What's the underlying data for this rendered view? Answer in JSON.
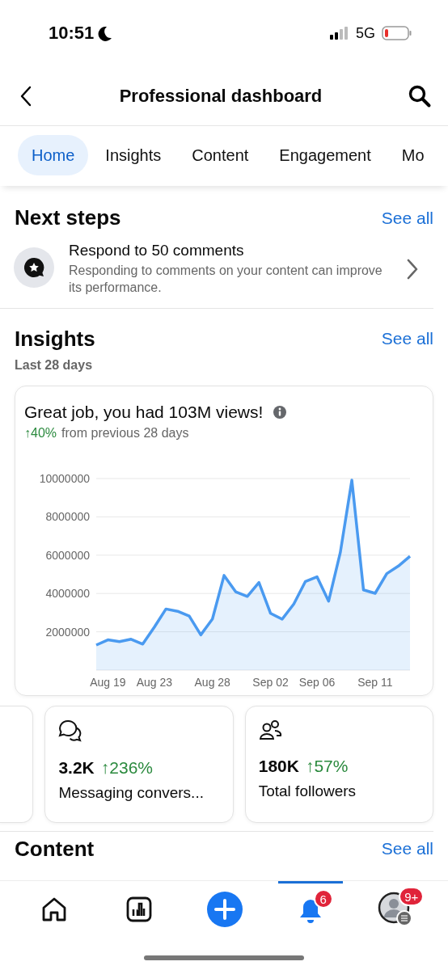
{
  "status_bar": {
    "time": "10:51",
    "network": "5G"
  },
  "header": {
    "title": "Professional dashboard"
  },
  "tabs": [
    {
      "label": "Home",
      "selected": true
    },
    {
      "label": "Insights",
      "selected": false
    },
    {
      "label": "Content",
      "selected": false
    },
    {
      "label": "Engagement",
      "selected": false
    },
    {
      "label": "Mo",
      "selected": false
    }
  ],
  "next_steps": {
    "title": "Next steps",
    "link": "See all",
    "items": [
      {
        "title": "Respond to 50 comments",
        "description": "Responding to comments on your content can improve its performance."
      }
    ]
  },
  "insights": {
    "title": "Insights",
    "link": "See all",
    "period": "Last 28 days",
    "card": {
      "headline": "Great job, you had 103M views!",
      "change": "↑40%",
      "change_text": "from previous 28 days",
      "chart_data": {
        "type": "area",
        "grid": true,
        "categories": [
          null,
          "Aug 19",
          null,
          null,
          null,
          "Aug 23",
          null,
          null,
          null,
          null,
          "Aug 28",
          null,
          null,
          null,
          null,
          "Sep 02",
          null,
          null,
          null,
          "Sep 06",
          null,
          null,
          null,
          null,
          "Sep 11",
          null,
          null,
          null
        ],
        "series": [
          {
            "color": "#4a9af0",
            "values": [
              1310000,
              1580000,
              1490000,
              1610000,
              1360000,
              2250000,
              3190000,
              3070000,
              2820000,
              1840000,
              2670000,
              4940000,
              4090000,
              3850000,
              4570000,
              2960000,
              2660000,
              3450000,
              4630000,
              4870000,
              3600000,
              6130000,
              9910000,
              4190000,
              4010000,
              5040000,
              5430000,
              5940000
            ]
          }
        ],
        "ylim": [
          0,
          10000000
        ],
        "yticks": [
          2000000,
          4000000,
          6000000,
          8000000,
          10000000
        ]
      }
    },
    "metrics": [
      {
        "kind": "messages",
        "value": "3.2K",
        "change": "↑236%",
        "label": "Messaging convers..."
      },
      {
        "kind": "followers",
        "value": "180K",
        "change": "↑57%",
        "label": "Total followers"
      }
    ]
  },
  "content": {
    "title": "Content",
    "link": "See all"
  },
  "bottom_nav": [
    {
      "kind": "home",
      "selected": false
    },
    {
      "kind": "stats",
      "selected": false
    },
    {
      "kind": "create",
      "selected": false
    },
    {
      "kind": "notifications",
      "selected": true,
      "badge": "6"
    },
    {
      "kind": "profile",
      "selected": false,
      "badge": "9+"
    }
  ]
}
